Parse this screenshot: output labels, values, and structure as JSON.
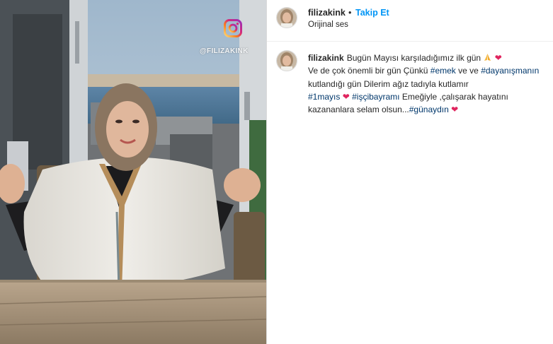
{
  "post": {
    "watermark": "@FILIZAKINK",
    "username": "filizakink",
    "separator": "•",
    "follow_label": "Takip Et",
    "audio_label": "Orijinal ses"
  },
  "caption": {
    "username": "filizakink",
    "line1": "Bugün Mayısı karşıladığımız ilk gün",
    "line2_a": "Ve de çok önemli bir gün Çünkü",
    "tag_emek": "#emek",
    "line2_b": "ve ve",
    "tag_dayanisma": "#dayanışmanın",
    "line3": "kutlandığı gün Dilerim ağız tadıyla kutlamır",
    "tag_1mayis": "#1mayıs",
    "tag_iscibayrami": "#işçibayramı",
    "line4_b": "Emeğiyle ,çalışarak hayatını",
    "line5_a": "kazananlara selam olsun...",
    "tag_gunaydin": "#günaydın",
    "heart": "❤"
  },
  "icons": {
    "instagram": "instagram-icon",
    "avatar": "avatar",
    "heart": "heart-icon",
    "pray": "pray-emoji-icon"
  },
  "colors": {
    "follow": "#0095f6",
    "hashtag": "#00376b",
    "heart": "#e0245e",
    "text": "#262626"
  }
}
